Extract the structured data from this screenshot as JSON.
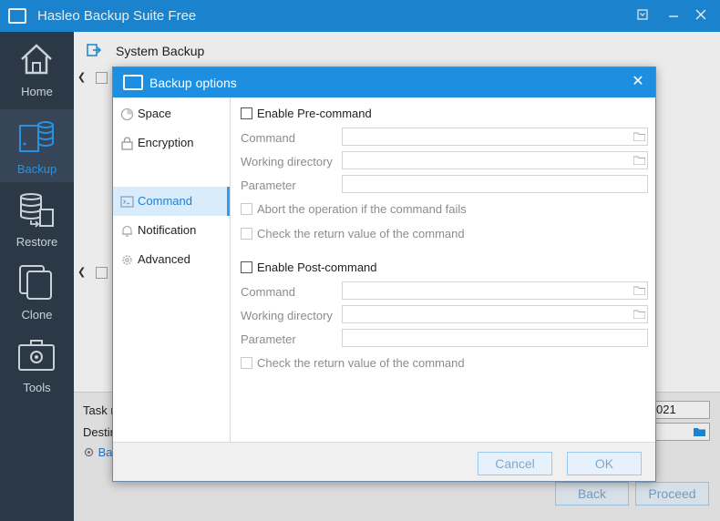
{
  "window": {
    "title": "Hasleo Backup Suite Free",
    "controls": [
      "dropdown-icon",
      "minimize-icon",
      "close-icon"
    ]
  },
  "sidebar": {
    "items": [
      {
        "label": "Home",
        "icon": "home-icon",
        "active": false
      },
      {
        "label": "Backup",
        "icon": "backup-icon",
        "active": true
      },
      {
        "label": "Restore",
        "icon": "restore-icon",
        "active": false
      },
      {
        "label": "Clone",
        "icon": "clone-icon",
        "active": false
      },
      {
        "label": "Tools",
        "icon": "tools-icon",
        "active": false
      }
    ]
  },
  "main": {
    "title": "System Backup",
    "task_label": "Task r",
    "task_value": "021",
    "dest_label": "Destin",
    "settings_link": "Ba",
    "back_label": "Back",
    "proceed_label": "Proceed"
  },
  "dialog": {
    "title": "Backup options",
    "nav": [
      {
        "label": "Space",
        "icon": "space-icon",
        "active": false
      },
      {
        "label": "Encryption",
        "icon": "lock-icon",
        "active": false
      },
      {
        "label": "Command",
        "icon": "command-icon",
        "active": true
      },
      {
        "label": "Notification",
        "icon": "bell-icon",
        "active": false
      },
      {
        "label": "Advanced",
        "icon": "gear-icon",
        "active": false
      }
    ],
    "pre": {
      "enable_label": "Enable Pre-command",
      "command_label": "Command",
      "workdir_label": "Working directory",
      "param_label": "Parameter",
      "abort_label": "Abort the operation if the command fails",
      "check_label": "Check the return value of the command"
    },
    "post": {
      "enable_label": "Enable Post-command",
      "command_label": "Command",
      "workdir_label": "Working directory",
      "param_label": "Parameter",
      "check_label": "Check the return value of the command"
    },
    "cancel_label": "Cancel",
    "ok_label": "OK"
  },
  "colors": {
    "accent": "#1e8fe0",
    "sidebar_bg": "#2f3d4c",
    "active_text": "#2ba0f3"
  }
}
